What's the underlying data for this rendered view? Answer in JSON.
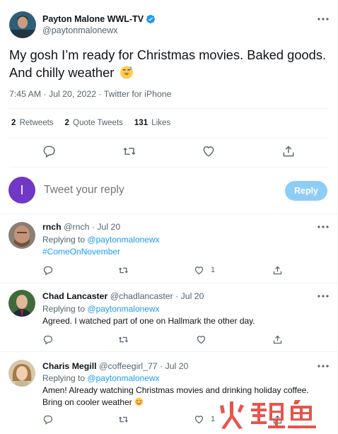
{
  "tweet": {
    "author_name": "Payton Malone WWL-TV",
    "author_handle": "@paytonmalonewx",
    "text": "My gosh I’m ready for Christmas movies. Baked goods. And chilly weather",
    "emoji": "sweat-smile-emoji",
    "timestamp": "7:45 AM · Jul 20, 2022 · Twitter for iPhone",
    "stats": [
      {
        "count": "2",
        "label": "Retweets"
      },
      {
        "count": "2",
        "label": "Quote Tweets"
      },
      {
        "count": "131",
        "label": "Likes"
      }
    ]
  },
  "compose": {
    "avatar_letter": "I",
    "placeholder": "Tweet your reply",
    "button_label": "Reply"
  },
  "replies": [
    {
      "name": "rnch",
      "meta": "@rnch · Jul 20",
      "replying_label": "Replying to",
      "replying_to": "@paytonmalonewx",
      "text": "#ComeOnNovember",
      "text_is_link": true,
      "like_count": "1"
    },
    {
      "name": "Chad Lancaster",
      "meta": "@chadlancaster · Jul 20",
      "replying_label": "Replying to",
      "replying_to": "@paytonmalonewx",
      "text": "Agreed. I watched part of one on Hallmark the other day.",
      "like_count": ""
    },
    {
      "name": "Charis Megill",
      "meta": "@coffeegirl_77 · Jul 20",
      "replying_label": "Replying to",
      "replying_to": "@paytonmalonewx",
      "text": "Amen! Already watching Christmas movies and drinking holiday coffee.",
      "text2": "Bring on cooler weather",
      "like_count": "1"
    }
  ],
  "watermark": {
    "text": "火鲤鱼"
  },
  "colors": {
    "accent": "#1d9bf0",
    "muted": "#536471",
    "reply_button": "#8ecdf7",
    "watermark": "#e8463a"
  }
}
